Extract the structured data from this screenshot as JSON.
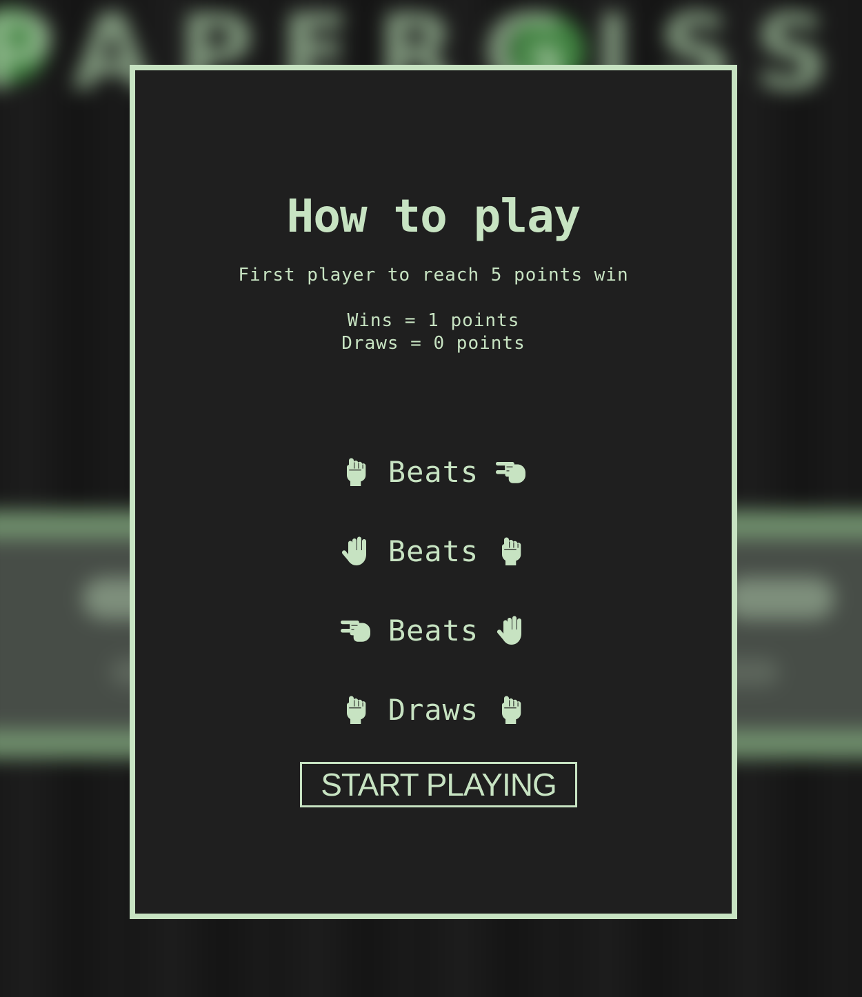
{
  "colors": {
    "accent": "#c7e3c2",
    "panel": "#1f1f1f",
    "background": "#141414"
  },
  "background": {
    "title_text": "PAPERGISS"
  },
  "modal": {
    "title": "How to play",
    "subtitle": "First player to reach 5 points win",
    "rules": {
      "wins": "Wins = 1 points",
      "draws": "Draws = 0 points"
    },
    "matchups": [
      {
        "left_icon": "rock-icon",
        "verb": "Beats",
        "right_icon": "scissors-icon"
      },
      {
        "left_icon": "paper-icon",
        "verb": "Beats",
        "right_icon": "rock-icon"
      },
      {
        "left_icon": "scissors-icon",
        "verb": "Beats",
        "right_icon": "paper-icon"
      },
      {
        "left_icon": "rock-icon",
        "verb": "Draws",
        "right_icon": "rock-icon"
      }
    ],
    "start_button_label": "START PLAYING"
  }
}
